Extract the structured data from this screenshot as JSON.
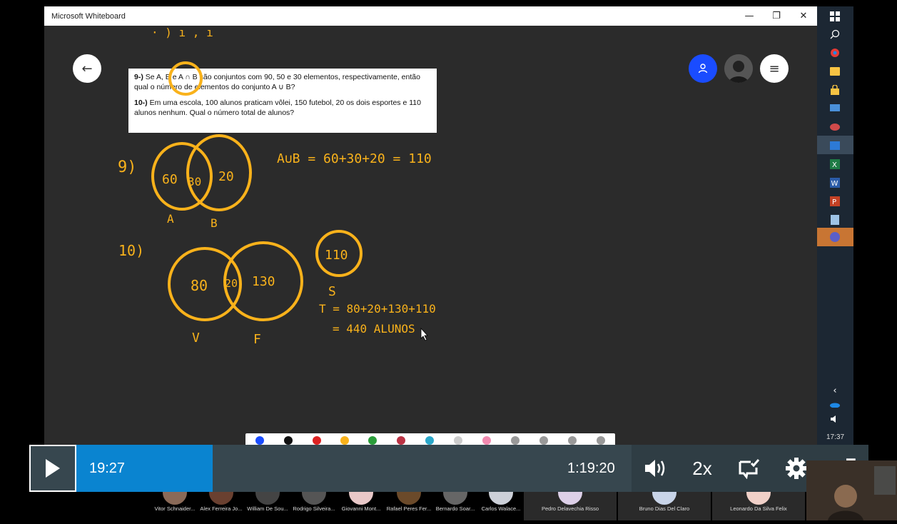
{
  "window": {
    "title": "Microsoft Whiteboard",
    "minimize_glyph": "—",
    "restore_glyph": "❐",
    "close_glyph": "✕"
  },
  "canvas": {
    "back_glyph": "←",
    "invite_icon": "person-icon",
    "menu_glyph": "≡",
    "question_card": {
      "q9_label": "9-)",
      "q9_text": " Se A, B e A ∩ B são conjuntos com 90, 50 e 30 elementos, respectivamente, então qual  o número de elementos do conjunto A ∪ B?",
      "q10_label": "10-)",
      "q10_text": " Em uma escola, 100 alunos praticam vôlei, 150 futebol, 20 os dois esportes e 110 alunos nenhum. Qual o número total de alunos?"
    },
    "handwriting": {
      "top_scrap": "· ) ı , ı",
      "p9_label": "9)",
      "p9_a_only": "60",
      "p9_both": "30",
      "p9_b_only": "20",
      "p9_set_a": "A",
      "p9_set_b": "B",
      "p9_formula": "A∪B = 60+30+20 = 110",
      "p10_label": "10)",
      "p10_v_only": "80",
      "p10_both": "20",
      "p10_f_only": "130",
      "p10_set_v": "V",
      "p10_set_f": "F",
      "p10_none": "110",
      "p10_set_s": "S",
      "p10_total_line1": "T = 80+20+130+110",
      "p10_total_line2": "= 440 ALUNOS"
    },
    "ink_color": "#f9b21b"
  },
  "taskbar": {
    "icons": [
      "windows-icon",
      "search-icon",
      "chrome-icon",
      "file-explorer-icon",
      "lock-icon",
      "remote-desktop-icon",
      "paint-icon",
      "whiteboard-icon",
      "excel-icon",
      "word-icon",
      "powerpoint-icon",
      "notes-icon",
      "teams-icon"
    ],
    "tray_chevron": "‹",
    "clock": "17:37"
  },
  "player": {
    "current_time": "19:27",
    "total_time": "1:19:20",
    "speed": "2x",
    "progress_fraction": 0.245
  },
  "participants": [
    "Vitor Schnaider...",
    "Alex Ferreira Jo...",
    "William De Sou...",
    "Rodrigo Silveira...",
    "Giovanni Mont...",
    "Rafael Peres Fer...",
    "Bernardo Soar...",
    "Carlos Walace...",
    "Pedro Delavechia Risso",
    "Bruno Dias Del Claro",
    "Leonardo Da Silva Felix"
  ]
}
